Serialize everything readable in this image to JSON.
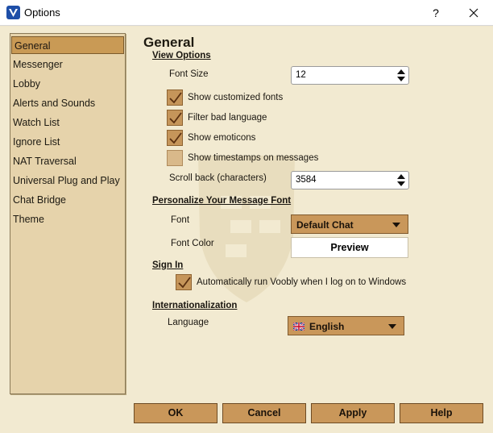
{
  "window": {
    "title": "Options",
    "help_label": "?"
  },
  "sidebar": {
    "items": [
      {
        "label": "General"
      },
      {
        "label": "Messenger"
      },
      {
        "label": "Lobby"
      },
      {
        "label": "Alerts and Sounds"
      },
      {
        "label": "Watch List"
      },
      {
        "label": "Ignore List"
      },
      {
        "label": "NAT Traversal"
      },
      {
        "label": "Universal Plug and Play"
      },
      {
        "label": "Chat Bridge"
      },
      {
        "label": "Theme"
      }
    ],
    "selected": "General"
  },
  "general": {
    "title": "General",
    "view_options": {
      "heading": "View Options",
      "font_size_label": "Font Size",
      "font_size_value": "12",
      "checkboxes": [
        {
          "label": "Show customized fonts",
          "checked": true
        },
        {
          "label": "Filter bad language",
          "checked": true
        },
        {
          "label": "Show emoticons",
          "checked": true
        },
        {
          "label": "Show timestamps on messages",
          "checked": false
        }
      ],
      "scroll_back_label": "Scroll back (characters)",
      "scroll_back_value": "3584"
    },
    "font": {
      "heading": "Personalize Your Message Font",
      "font_label": "Font",
      "font_value": "Default Chat",
      "color_label": "Font Color",
      "preview_label": "Preview"
    },
    "sign_in": {
      "heading": "Sign In",
      "auto_run_label": "Automatically run Voobly when I log on to Windows",
      "auto_run_checked": true
    },
    "i18n": {
      "heading": "Internationalization",
      "language_label": "Language",
      "language_value": "English"
    }
  },
  "buttons": {
    "ok": "OK",
    "cancel": "Cancel",
    "apply": "Apply",
    "help": "Help"
  },
  "colors": {
    "accent": "#c9975a",
    "panel": "#e6d3ab",
    "background": "#f2ead1"
  }
}
